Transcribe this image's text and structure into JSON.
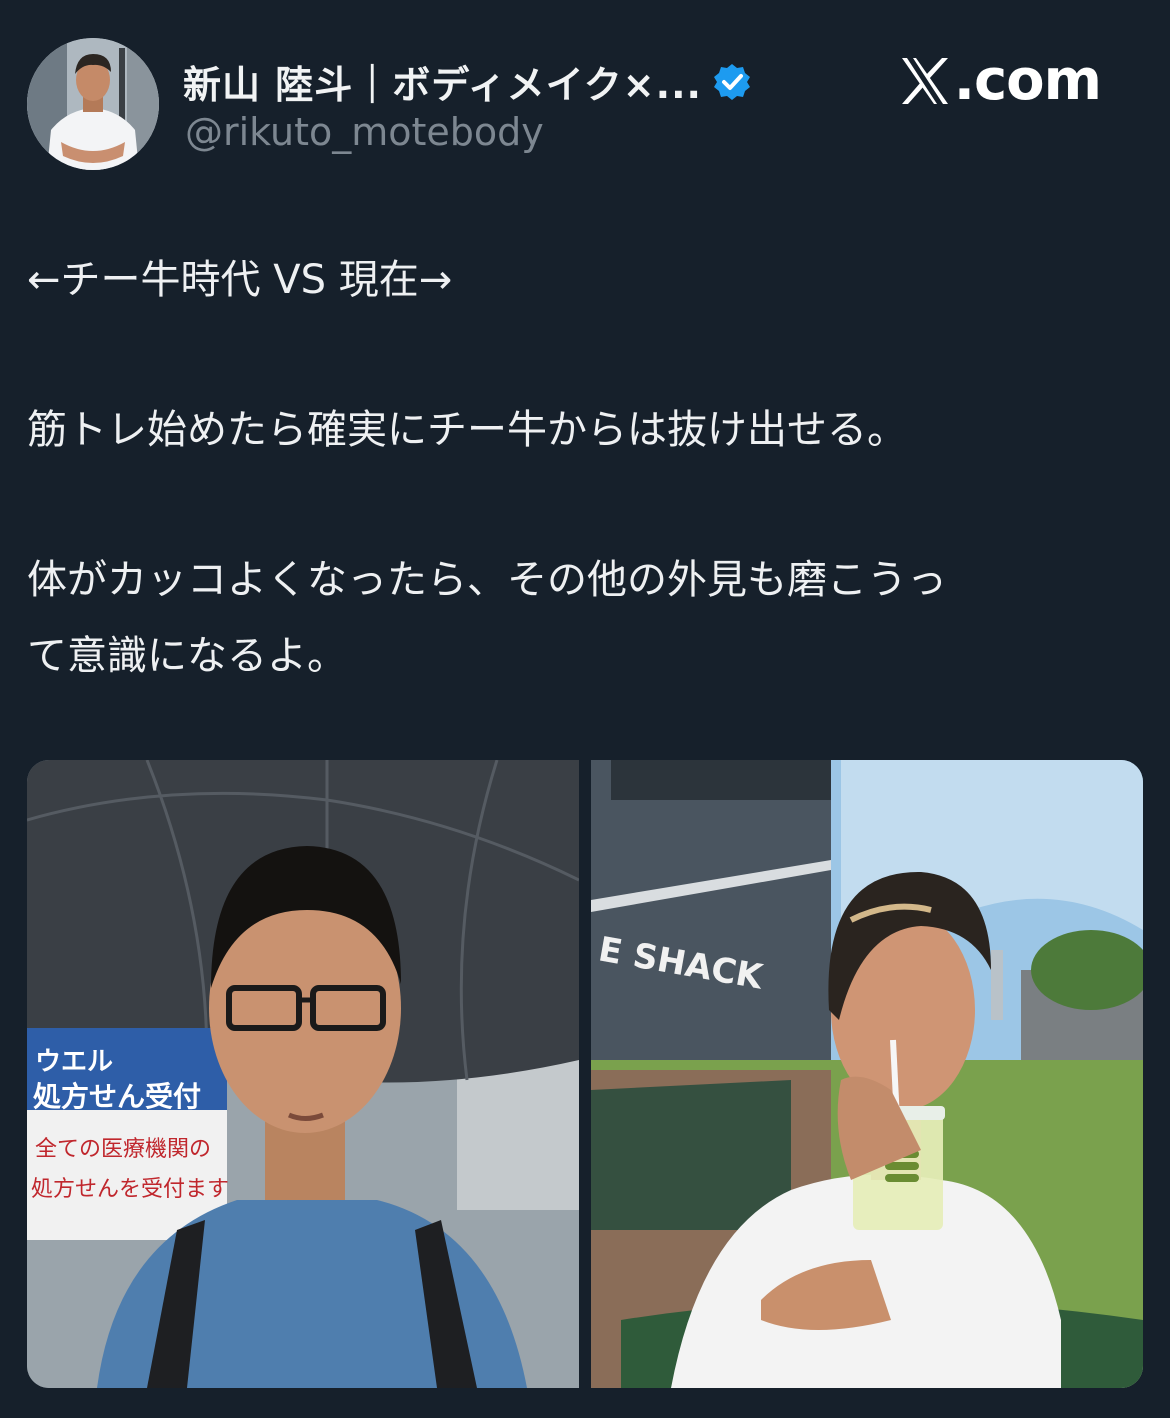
{
  "header": {
    "display_name": "新山 陸斗｜ボディメイク×...",
    "handle": "@rikuto_motebody",
    "site_logo": "X.com",
    "site_text": ".com",
    "verified_icon": "verified-badge-icon"
  },
  "tweet": {
    "lines": [
      "←チー牛時代 VS 現在→",
      "筋トレ始めたら確実にチー牛からは抜け出せる。",
      "体がカッコよくなったら、その他の外見も磨こうっ",
      "て意識になるよ。"
    ]
  },
  "media": {
    "left_photo": {
      "sign_lines": [
        "ウエル",
        "処方せん受付",
        "全ての医療機関の",
        "処方せんを受付ます"
      ]
    },
    "right_photo": {
      "store_sign": "E SHACK"
    }
  },
  "colors": {
    "background": "#16202b",
    "text": "#e7e9ea",
    "handle": "#7d8791",
    "verified": "#1d9bf0"
  }
}
